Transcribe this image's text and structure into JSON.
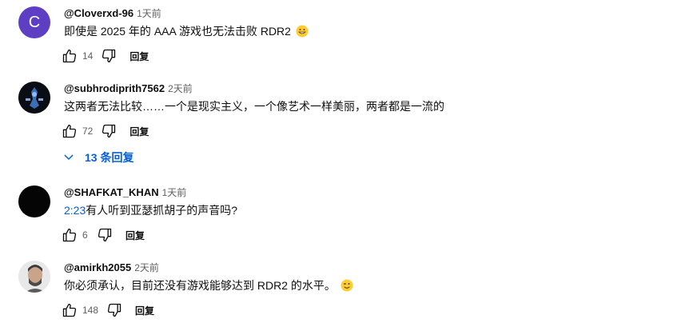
{
  "comments": [
    {
      "avatar_letter": "C",
      "author": "@Cloverxd-96",
      "time": "1天前",
      "text": "即使是 2025 年的 AAA 游戏也无法击败 RDR2",
      "emoji": "grinning-face-emoji",
      "likes": "14",
      "reply_label": "回复"
    },
    {
      "author": "@subhrodiprith7562",
      "time": "2天前",
      "text": "这两者无法比较……一个是现实主义，一个像艺术一样美丽，两者都是一流的",
      "likes": "72",
      "reply_label": "回复",
      "replies_toggle": "13 条回复"
    },
    {
      "author": "@SHAFKAT_KHAN",
      "time": "1天前",
      "timestamp_link": "2:23",
      "text": "有人听到亚瑟抓胡子的声音吗?",
      "likes": "6",
      "reply_label": "回复"
    },
    {
      "author": "@amirkh2055",
      "time": "2天前",
      "text": "你必须承认，目前还没有游戏能够达到 RDR2 的水平。",
      "emoji": "winking-face-emoji",
      "likes": "148",
      "reply_label": "回复"
    }
  ],
  "colors": {
    "link": "#065fd4",
    "avatar_c": "#5e3fc3",
    "secondary_text": "#606060"
  }
}
